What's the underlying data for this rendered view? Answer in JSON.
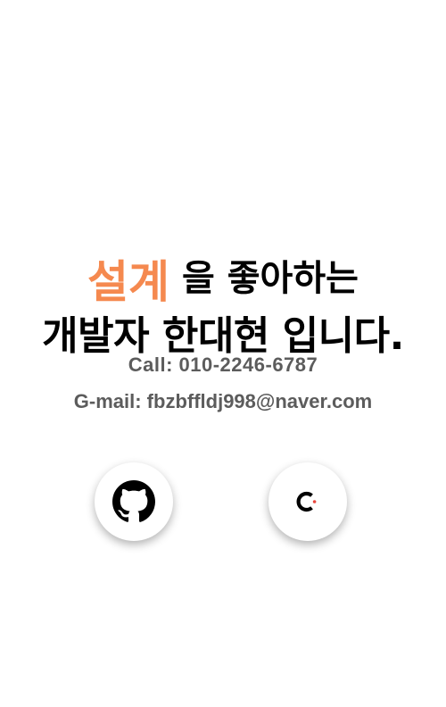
{
  "headline": {
    "highlight_word": "설계",
    "line1_rest": "을 좋아하는",
    "line2": "개발자 한대현 입니다."
  },
  "contact": {
    "call": "Call: 010-2246-6787",
    "gmail": "G-mail: fbzbffldj998@naver.com"
  },
  "social": [
    {
      "icon": "github-icon"
    },
    {
      "icon": "velog-c-icon"
    }
  ],
  "colors": {
    "accent": "#f5894f",
    "text": "#000000",
    "contact_text": "#5c5c5c",
    "background": "#ffffff",
    "dot_red": "#e8453c"
  }
}
